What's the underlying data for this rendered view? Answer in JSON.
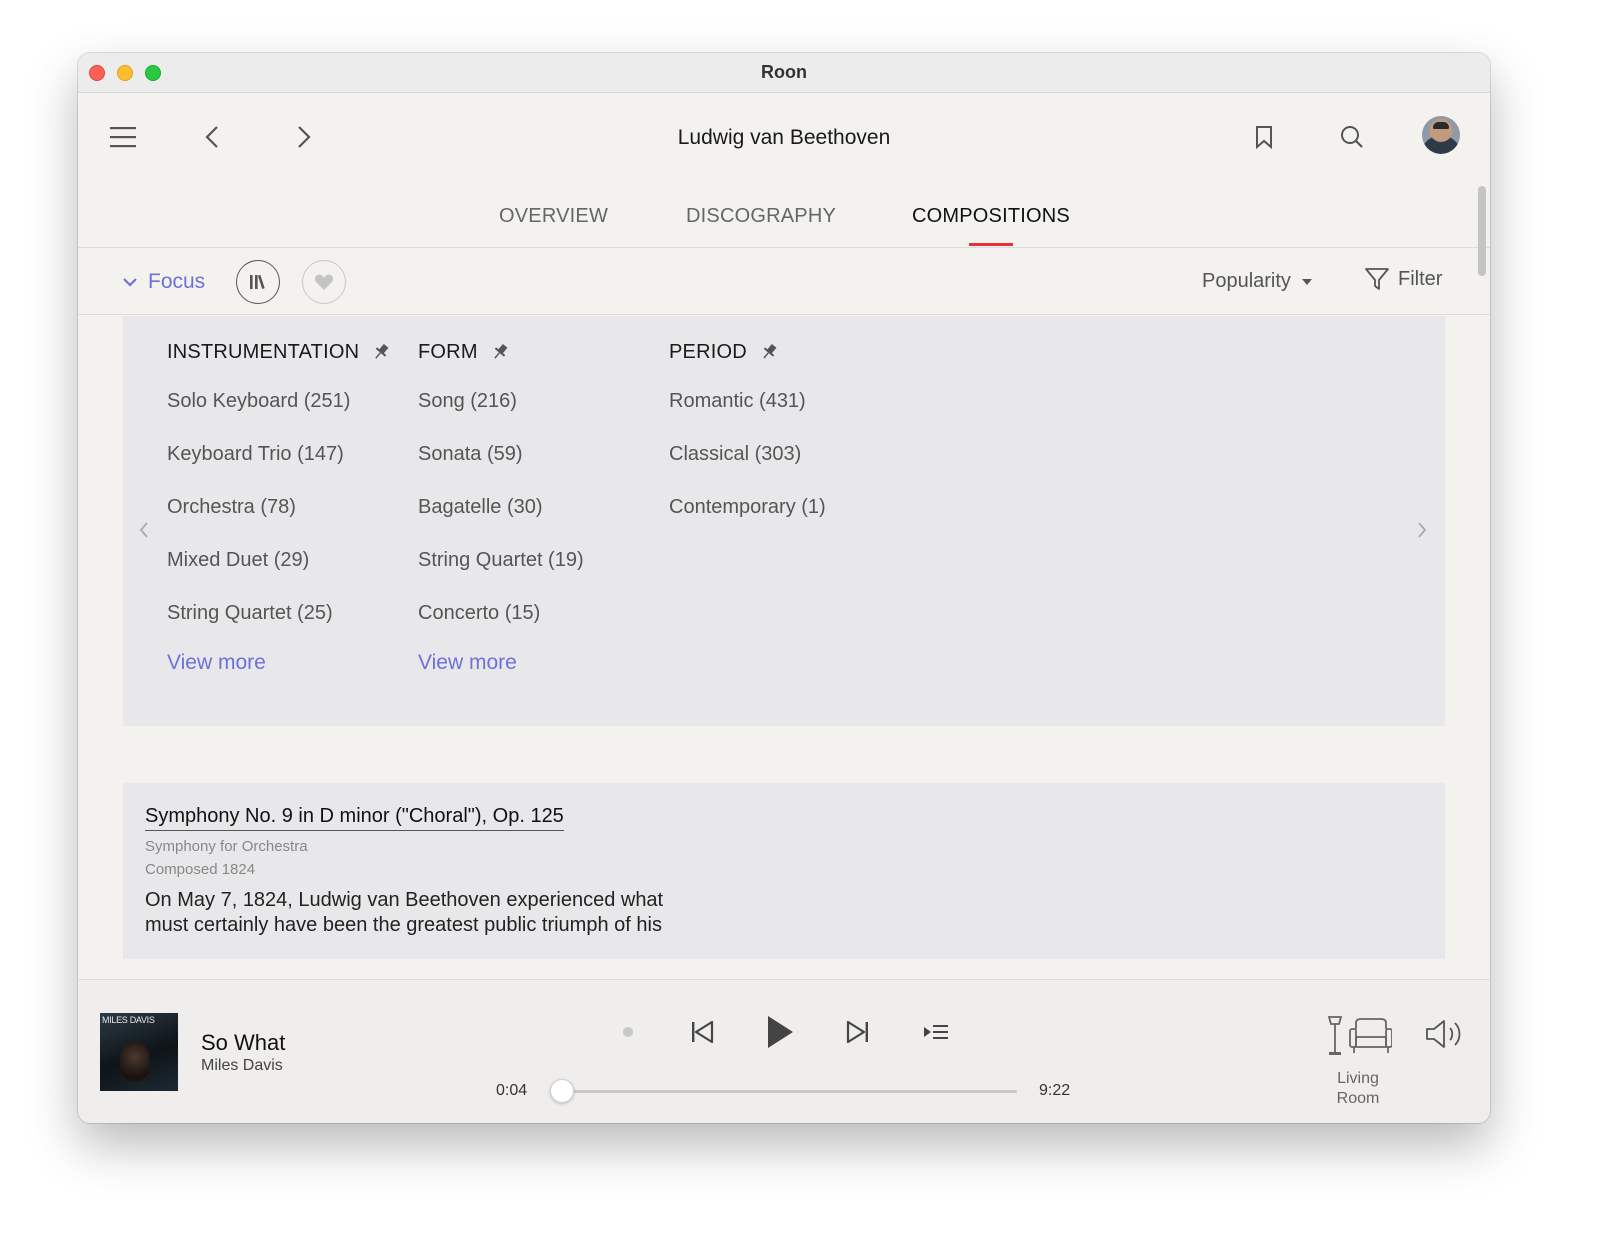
{
  "window": {
    "title": "Roon"
  },
  "header": {
    "title": "Ludwig van Beethoven"
  },
  "tabs": [
    {
      "label": "OVERVIEW",
      "active": false
    },
    {
      "label": "DISCOGRAPHY",
      "active": false
    },
    {
      "label": "COMPOSITIONS",
      "active": true
    }
  ],
  "focus": {
    "label": "Focus",
    "sort_label": "Popularity",
    "filter_label": "Filter"
  },
  "facets": [
    {
      "header": "INSTRUMENTATION",
      "items": [
        "Solo Keyboard (251)",
        "Keyboard Trio (147)",
        "Orchestra (78)",
        "Mixed Duet (29)",
        "String Quartet (25)"
      ],
      "view_more": "View more"
    },
    {
      "header": "FORM",
      "items": [
        "Song (216)",
        "Sonata (59)",
        "Bagatelle (30)",
        "String Quartet (19)",
        "Concerto (15)"
      ],
      "view_more": "View more"
    },
    {
      "header": "PERIOD",
      "items": [
        "Romantic (431)",
        "Classical (303)",
        "Contemporary (1)"
      ]
    }
  ],
  "composition": {
    "title": "Symphony No. 9 in D minor (\"Choral\"), Op. 125",
    "form": "Symphony for Orchestra",
    "composed": "Composed 1824",
    "description": "On May 7, 1824, Ludwig van Beethoven experienced what must certainly have been the greatest public triumph of his"
  },
  "player": {
    "track_title": "So What",
    "artist": "Miles Davis",
    "album_art_text": "MILES DAVIS",
    "elapsed": "0:04",
    "duration": "9:22",
    "progress_fraction": 0.007,
    "zone_name": "Living Room"
  },
  "colors": {
    "accent": "#6c72d8",
    "tab_underline": "#e5323a",
    "panel_bg": "#e8e8ea",
    "window_bg": "#f3f2ef"
  },
  "icons": {
    "menu": "hamburger-icon",
    "back": "chevron-left-icon",
    "forward": "chevron-right-icon",
    "bookmark": "bookmark-icon",
    "search": "search-icon",
    "library": "library-icon",
    "favorite": "heart-icon",
    "pin": "pin-icon"
  }
}
